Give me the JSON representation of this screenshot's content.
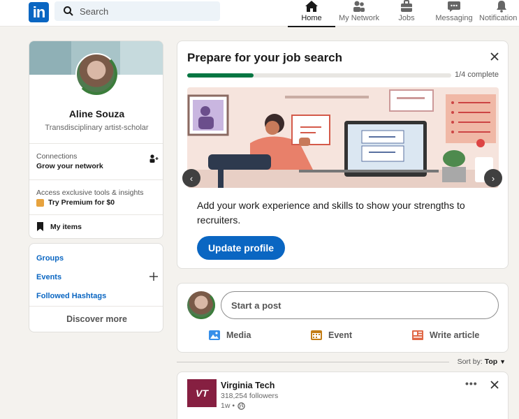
{
  "nav": {
    "logo": "in",
    "search_placeholder": "Search",
    "items": [
      {
        "label": "Home",
        "icon": "home-icon",
        "active": true
      },
      {
        "label": "My Network",
        "icon": "network-icon"
      },
      {
        "label": "Jobs",
        "icon": "briefcase-icon"
      },
      {
        "label": "Messaging",
        "icon": "messaging-icon"
      },
      {
        "label": "Notification",
        "icon": "bell-icon"
      }
    ]
  },
  "profile": {
    "name": "Aline Souza",
    "tagline": "Transdisciplinary artist-scholar",
    "connections_label": "Connections",
    "connections_action": "Grow your network",
    "premium_text": "Access exclusive tools & insights",
    "premium_cta": "Try Premium for $0",
    "my_items": "My items"
  },
  "links": {
    "groups": "Groups",
    "events": "Events",
    "hashtags": "Followed Hashtags",
    "discover": "Discover more"
  },
  "job_card": {
    "title": "Prepare for your job search",
    "progress_text": "1/4 complete",
    "progress": 0.25,
    "description": "Add your work experience and skills to show your strengths to recruiters.",
    "button": "Update profile"
  },
  "post_box": {
    "placeholder": "Start a post",
    "actions": [
      "Media",
      "Event",
      "Write article"
    ]
  },
  "sort": {
    "label": "Sort by:",
    "value": "Top"
  },
  "feed": {
    "org": "Virginia Tech",
    "logo_text": "VT",
    "followers": "318,254 followers",
    "time": "1w •"
  },
  "colors": {
    "brand": "#0a66c2",
    "progress": "#057642",
    "vt": "#861f41"
  }
}
